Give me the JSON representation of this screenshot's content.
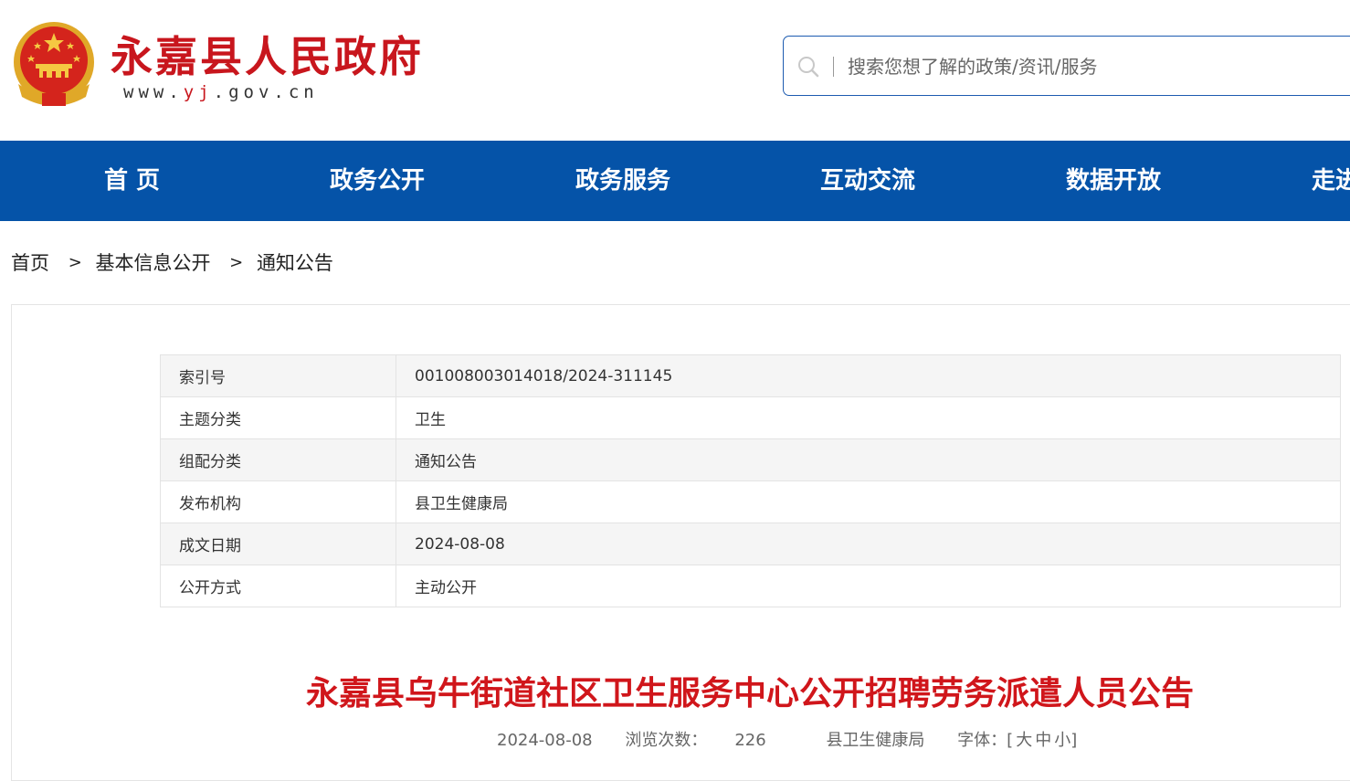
{
  "header": {
    "site_title": "永嘉县人民政府",
    "url_prefix": "www.",
    "url_highlight": "yj",
    "url_suffix": ".gov.cn",
    "brand_red": "#c8161d",
    "search": {
      "placeholder": "搜索您想了解的政策/资讯/服务",
      "value": ""
    }
  },
  "nav": {
    "color": "#0553a8",
    "items": [
      {
        "label": "首 页"
      },
      {
        "label": "政务公开"
      },
      {
        "label": "政务服务"
      },
      {
        "label": "互动交流"
      },
      {
        "label": "数据开放"
      },
      {
        "label": "走进"
      }
    ]
  },
  "breadcrumb": {
    "items": [
      "首页",
      "基本信息公开",
      "通知公告"
    ],
    "separator": ">"
  },
  "meta": {
    "rows": [
      {
        "label": "索引号",
        "value": "001008003014018/2024-311145"
      },
      {
        "label": "主题分类",
        "value": "卫生"
      },
      {
        "label": "组配分类",
        "value": "通知公告"
      },
      {
        "label": "发布机构",
        "value": "县卫生健康局"
      },
      {
        "label": "成文日期",
        "value": "2024-08-08"
      },
      {
        "label": "公开方式",
        "value": "主动公开"
      }
    ]
  },
  "article": {
    "title": "永嘉县乌牛街道社区卫生服务中心公开招聘劳务派遣人员公告",
    "date": "2024-08-08",
    "views_label": "浏览次数：",
    "views": "226",
    "source": "县卫生健康局",
    "font_label": "字体：",
    "font_open": "[",
    "font_large": "大",
    "font_medium": "中",
    "font_small": "小",
    "font_close": "]"
  }
}
